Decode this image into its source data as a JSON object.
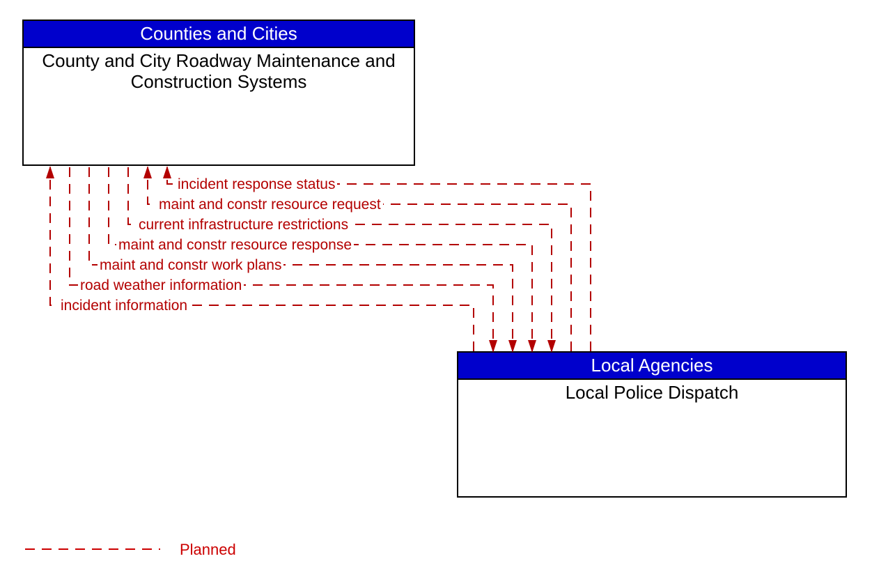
{
  "entities": {
    "top": {
      "header": "Counties and Cities",
      "body": "County and City Roadway Maintenance and Construction Systems"
    },
    "bottom": {
      "header": "Local Agencies",
      "body": "Local Police Dispatch"
    }
  },
  "flows": {
    "f1": "incident response status",
    "f2": "maint and constr resource request",
    "f3": "current infrastructure restrictions",
    "f4": "maint and constr resource response",
    "f5": "maint and constr work plans",
    "f6": "road weather information",
    "f7": "incident information"
  },
  "legend": {
    "planned": "Planned"
  },
  "colors": {
    "header_bg": "#0000cc",
    "flow": "#b30000"
  }
}
